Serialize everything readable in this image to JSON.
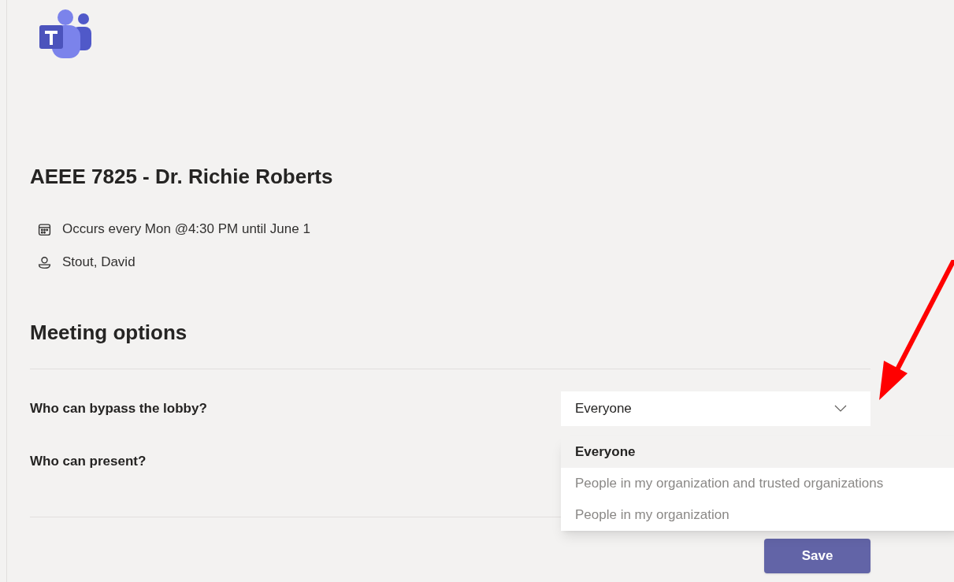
{
  "meeting_title": "AEEE 7825 - Dr. Richie Roberts",
  "details": [
    {
      "kind": "recurrence",
      "text": "Occurs every Mon @4:30 PM until June 1"
    },
    {
      "kind": "organizer",
      "text": "Stout, David"
    }
  ],
  "section_title": "Meeting options",
  "options": [
    {
      "label": "Who can bypass the lobby?",
      "value": "Everyone",
      "expanded": true,
      "menu": [
        {
          "label": "Everyone",
          "selected": true
        },
        {
          "label": "People in my organization and trusted organizations",
          "selected": false
        },
        {
          "label": "People in my organization",
          "selected": false
        }
      ]
    },
    {
      "label": "Who can present?"
    }
  ],
  "save_button": "Save"
}
